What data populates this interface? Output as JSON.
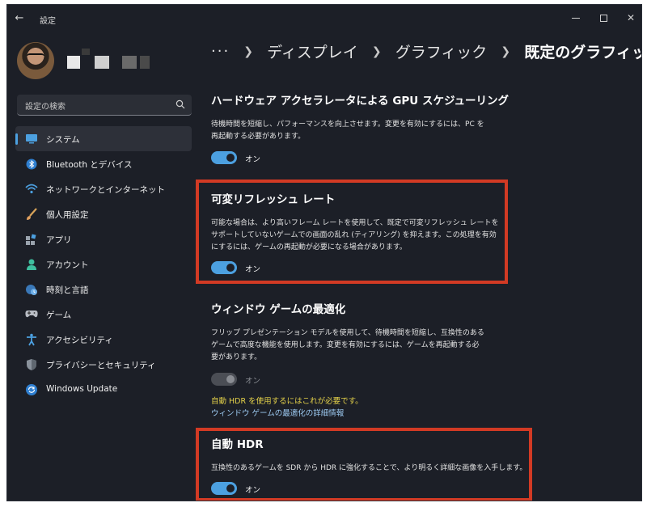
{
  "window": {
    "title": "設定",
    "back_icon": "back-arrow-icon",
    "controls": [
      "minimize-icon",
      "maximize-icon",
      "close-icon"
    ]
  },
  "search": {
    "placeholder": "設定の検索"
  },
  "nav": {
    "items": [
      {
        "label": "システム",
        "icon": "display-icon",
        "selected": true
      },
      {
        "label": "Bluetooth とデバイス",
        "icon": "bluetooth-icon"
      },
      {
        "label": "ネットワークとインターネット",
        "icon": "wifi-icon"
      },
      {
        "label": "個人用設定",
        "icon": "brush-icon"
      },
      {
        "label": "アプリ",
        "icon": "apps-icon"
      },
      {
        "label": "アカウント",
        "icon": "account-icon"
      },
      {
        "label": "時刻と言語",
        "icon": "clock-globe-icon"
      },
      {
        "label": "ゲーム",
        "icon": "gamepad-icon"
      },
      {
        "label": "アクセシビリティ",
        "icon": "accessibility-icon"
      },
      {
        "label": "プライバシーとセキュリティ",
        "icon": "shield-icon"
      },
      {
        "label": "Windows Update",
        "icon": "update-icon"
      }
    ]
  },
  "breadcrumb": {
    "more": "···",
    "items": [
      "ディスプレイ",
      "グラフィック",
      "既定のグラフィック設定"
    ]
  },
  "sections": {
    "gpu": {
      "title": "ハードウェア アクセラレータによる GPU スケジューリング",
      "desc": [
        "待機時間を短縮し、パフォーマンスを向上させます。変更を有効にするには、PC を",
        "再起動する必要があります。"
      ],
      "toggle_label": "オン",
      "toggle_on": true
    },
    "vrr": {
      "title": "可変リフレッシュ レート",
      "desc": [
        "可能な場合は、より高いフレーム レートを使用して、既定で可変リフレッシュ レートを",
        "サポートしていないゲームでの画面の乱れ (ティアリング) を抑えます。この処理を有効",
        "にするには、ゲームの再起動が必要になる場合があります。"
      ],
      "toggle_label": "オン",
      "toggle_on": true
    },
    "windowed": {
      "title": "ウィンドウ ゲームの最適化",
      "desc": [
        "フリップ プレゼンテーション モデルを使用して、待機時間を短縮し、互換性のある",
        "ゲームで高度な機能を使用します。変更を有効にするには、ゲームを再起動する必",
        "要があります。"
      ],
      "toggle_label": "オン",
      "toggle_enabled": false,
      "warning": "自動 HDR を使用するにはこれが必要です。",
      "link": "ウィンドウ ゲームの最適化の詳細情報"
    },
    "autohdr": {
      "title": "自動 HDR",
      "desc": [
        "互換性のあるゲームを SDR から HDR に強化することで、より明るく詳細な画像を入手します。"
      ],
      "toggle_label": "オン",
      "toggle_on": true
    }
  },
  "colors": {
    "accent": "#4ca0e0",
    "highlight": "#d23a24",
    "warning": "#e6d34a",
    "link": "#9cc9f0"
  }
}
